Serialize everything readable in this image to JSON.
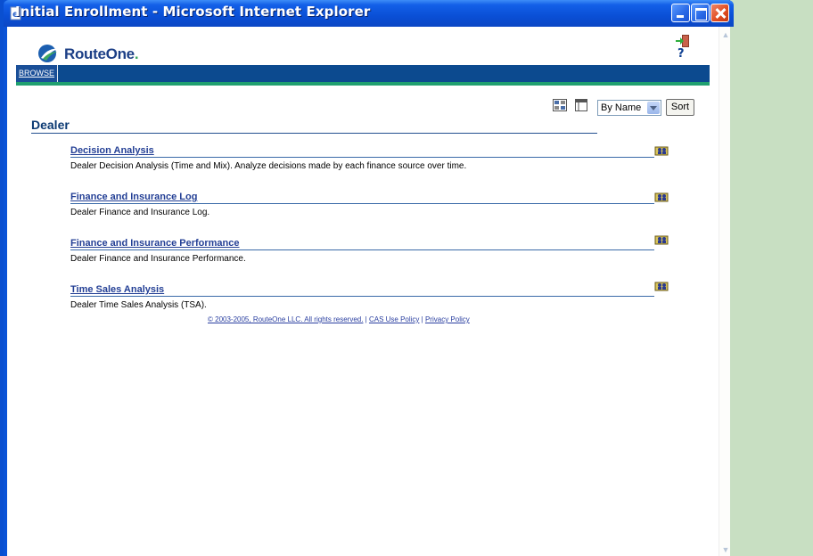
{
  "window": {
    "title": "Initial Enrollment - Microsoft Internet Explorer"
  },
  "header": {
    "logo_text": "RouteOne",
    "logo_dot": "."
  },
  "nav": {
    "browse_label": "BROWSE"
  },
  "toolbar": {
    "sort_select_value": "By Name",
    "sort_button_label": "Sort"
  },
  "section": {
    "title": "Dealer"
  },
  "items": [
    {
      "link": "Decision Analysis",
      "description": "Dealer Decision Analysis (Time and Mix). Analyze decisions made by each finance source over time."
    },
    {
      "link": "Finance and Insurance Log",
      "description": "Dealer Finance and Insurance Log."
    },
    {
      "link": "Finance and Insurance Performance",
      "description": "Dealer Finance and Insurance Performance."
    },
    {
      "link": "Time Sales Analysis",
      "description": "Dealer Time Sales Analysis (TSA)."
    }
  ],
  "footer": {
    "copyright": "© 2003-2005, RouteOne LLC. All rights reserved.",
    "sep1": " | ",
    "cas_policy": "CAS Use Policy",
    "sep2": " | ",
    "privacy_policy": "Privacy Policy"
  },
  "icons": {
    "title_icon": "ie-page-icon",
    "exit_icon": "exit-door-icon",
    "help_icon": "help-question-icon",
    "view1": "details-view-icon",
    "view2": "list-view-icon",
    "item_icon": "report-people-icon"
  },
  "colors": {
    "title_bar": "#0a4fd6",
    "nav_bar": "#0c4a8f",
    "nav_accent": "#20a070",
    "link": "#233f95"
  }
}
